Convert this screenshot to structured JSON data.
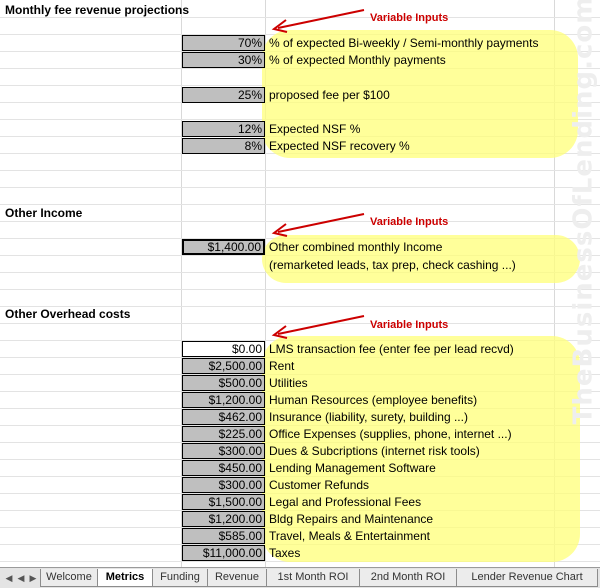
{
  "sections": {
    "monthly_fee": "Monthly fee revenue projections",
    "other_income": "Other Income",
    "overhead": "Other Overhead costs"
  },
  "variable_inputs_label": "Variable Inputs",
  "fee_rows": [
    {
      "value": "70%",
      "label": "% of expected Bi-weekly / Semi-monthly payments"
    },
    {
      "value": "30%",
      "label": "% of expected Monthly payments"
    },
    {
      "value": "25%",
      "label": "proposed fee per $100"
    },
    {
      "value": "12%",
      "label": "Expected NSF %"
    },
    {
      "value": "8%",
      "label": "Expected NSF recovery %"
    }
  ],
  "income_row": {
    "value": "$1,400.00",
    "label": "Other combined monthly Income",
    "sublabel": "(remarketed leads, tax prep, check cashing ...)"
  },
  "overhead_rows": [
    {
      "value": "$0.00",
      "label": "LMS transaction fee (enter fee per lead recvd)"
    },
    {
      "value": "$2,500.00",
      "label": "Rent"
    },
    {
      "value": "$500.00",
      "label": "Utilities"
    },
    {
      "value": "$1,200.00",
      "label": "Human Resources (employee benefits)"
    },
    {
      "value": "$462.00",
      "label": "Insurance (liability, surety, building ...)"
    },
    {
      "value": "$225.00",
      "label": "Office Expenses (supplies, phone, internet ...)"
    },
    {
      "value": "$300.00",
      "label": "Dues & Subcriptions (internet risk tools)"
    },
    {
      "value": "$450.00",
      "label": "Lending Management Software"
    },
    {
      "value": "$300.00",
      "label": "Customer Refunds"
    },
    {
      "value": "$1,500.00",
      "label": "Legal and Professional Fees"
    },
    {
      "value": "$1,200.00",
      "label": "Bldg Repairs and Maintenance"
    },
    {
      "value": "$585.00",
      "label": "Travel, Meals & Entertainment"
    },
    {
      "value": "$11,000.00",
      "label": "Taxes"
    }
  ],
  "watermark": "TheBusinessOfLending.com",
  "tabs": [
    "Welcome",
    "Metrics",
    "Funding",
    "Revenue",
    "1st Month ROI",
    "2nd Month ROI",
    "Lender Revenue Chart"
  ],
  "active_tab": "Metrics"
}
